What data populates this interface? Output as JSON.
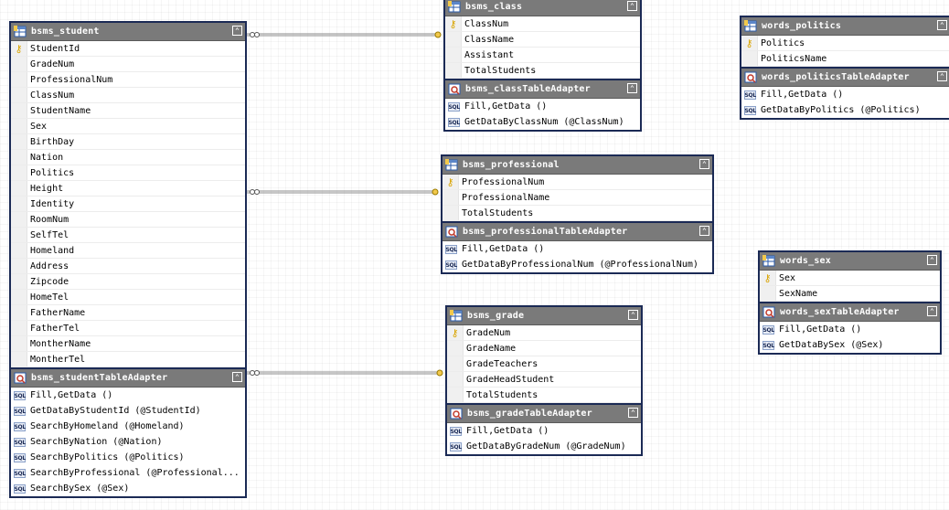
{
  "colors": {
    "border": "#1b2a55",
    "header": "#7a7a7a",
    "gutter": "#f0f0f0",
    "key": "#d9a400"
  },
  "icons": {
    "table": "table-icon",
    "adapter": "table-adapter-icon",
    "key": "primary-key-icon",
    "sql": "sql-query-icon",
    "collapse": "collapse-chevron-icon"
  },
  "tables": {
    "bsms_student": {
      "name": "bsms_student",
      "key": "StudentId",
      "columns": [
        "StudentId",
        "GradeNum",
        "ProfessionalNum",
        "ClassNum",
        "StudentName",
        "Sex",
        "BirthDay",
        "Nation",
        "Politics",
        "Height",
        "Identity",
        "RoomNum",
        "SelfTel",
        "Homeland",
        "Address",
        "Zipcode",
        "HomeTel",
        "FatherName",
        "FatherTel",
        "MontherName",
        "MontherTel"
      ],
      "adapter": "bsms_studentTableAdapter",
      "queries": [
        "Fill,GetData ()",
        "GetDataByStudentId (@StudentId)",
        "SearchByHomeland (@Homeland)",
        "SearchByNation (@Nation)",
        "SearchByPolitics (@Politics)",
        "SearchByProfessional (@Professional...",
        "SearchBySex (@Sex)"
      ]
    },
    "bsms_class": {
      "name": "bsms_class",
      "key": "ClassNum",
      "columns": [
        "ClassNum",
        "ClassName",
        "Assistant",
        "TotalStudents"
      ],
      "adapter": "bsms_classTableAdapter",
      "queries": [
        "Fill,GetData ()",
        "GetDataByClassNum (@ClassNum)"
      ]
    },
    "bsms_professional": {
      "name": "bsms_professional",
      "key": "ProfessionalNum",
      "columns": [
        "ProfessionalNum",
        "ProfessionalName",
        "TotalStudents"
      ],
      "adapter": "bsms_professionalTableAdapter",
      "queries": [
        "Fill,GetData ()",
        "GetDataByProfessionalNum (@ProfessionalNum)"
      ]
    },
    "bsms_grade": {
      "name": "bsms_grade",
      "key": "GradeNum",
      "columns": [
        "GradeNum",
        "GradeName",
        "GradeTeachers",
        "GradeHeadStudent",
        "TotalStudents"
      ],
      "adapter": "bsms_gradeTableAdapter",
      "queries": [
        "Fill,GetData ()",
        "GetDataByGradeNum (@GradeNum)"
      ]
    },
    "words_politics": {
      "name": "words_politics",
      "key": "Politics",
      "columns": [
        "Politics",
        "PoliticsName"
      ],
      "adapter": "words_politicsTableAdapter",
      "queries": [
        "Fill,GetData ()",
        "GetDataByPolitics (@Politics)"
      ]
    },
    "words_sex": {
      "name": "words_sex",
      "key": "Sex",
      "columns": [
        "Sex",
        "SexName"
      ],
      "adapter": "words_sexTableAdapter",
      "queries": [
        "Fill,GetData ()",
        "GetDataBySex (@Sex)"
      ]
    }
  }
}
